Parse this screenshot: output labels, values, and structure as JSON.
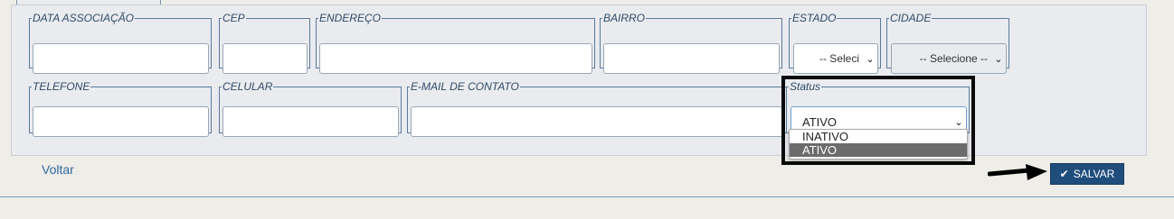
{
  "fields": {
    "data_associacao": {
      "label": "DATA ASSOCIAÇÃO",
      "value": ""
    },
    "cep": {
      "label": "CEP",
      "value": ""
    },
    "endereco": {
      "label": "ENDEREÇO",
      "value": ""
    },
    "bairro": {
      "label": "BAIRRO",
      "value": ""
    },
    "estado": {
      "label": "ESTADO",
      "selected": "-- Seleci"
    },
    "cidade": {
      "label": "CIDADE",
      "selected": "-- Selecione --"
    },
    "telefone": {
      "label": "TELEFONE",
      "value": ""
    },
    "celular": {
      "label": "CELULAR",
      "value": ""
    },
    "email": {
      "label": "E-MAIL DE CONTATO",
      "value": ""
    },
    "status": {
      "label": "Status",
      "selected": "ATIVO",
      "options": [
        "INATIVO",
        "ATIVO"
      ]
    }
  },
  "actions": {
    "voltar": "Voltar",
    "salvar": "SALVAR"
  },
  "icons": {
    "chevron": "chevron-down-icon",
    "check": "check-icon",
    "arrow": "arrow-right-icon"
  }
}
